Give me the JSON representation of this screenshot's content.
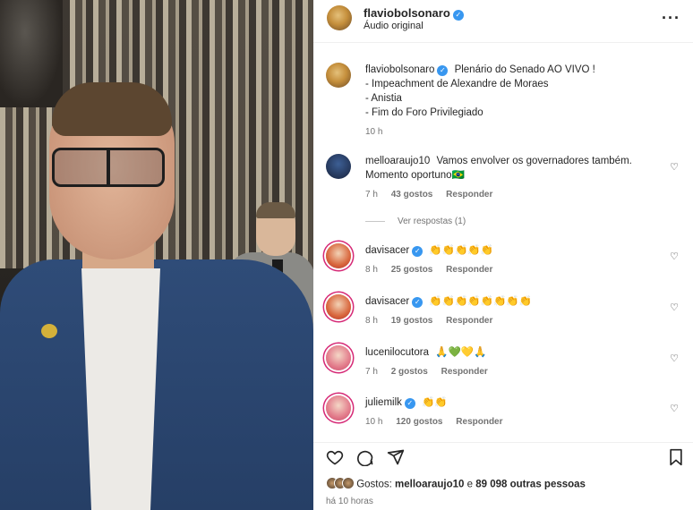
{
  "post": {
    "author": "flaviobolsonaro",
    "audio": "Áudio original",
    "more": "···",
    "caption": {
      "author": "flaviobolsonaro",
      "lines": [
        "Plenário do Senado AO VIVO !",
        "- Impeachment de Alexandre de Moraes",
        "- Anistia",
        "- Fim do Foro Privilegiado"
      ],
      "time": "10 h"
    }
  },
  "comments": [
    {
      "user": "melloaraujo10",
      "verified": false,
      "text_line1": "Vamos envolver os governadores também.",
      "text_line2": "Momento oportuno🇧🇷",
      "time": "7 h",
      "likes": "43 gostos",
      "reply": "Responder",
      "avatar": "avatar-blue"
    },
    {
      "user": "davisacer",
      "verified": true,
      "text": "👏👏👏👏👏",
      "time": "8 h",
      "likes": "25 gostos",
      "reply": "Responder",
      "avatar": "avatar-red"
    },
    {
      "user": "davisacer",
      "verified": true,
      "text": "👏👏👏👏👏👏👏👏",
      "time": "8 h",
      "likes": "19 gostos",
      "reply": "Responder",
      "avatar": "avatar-red"
    },
    {
      "user": "lucenilocutora",
      "verified": false,
      "text": "🙏💚💛🙏",
      "time": "7 h",
      "likes": "2 gostos",
      "reply": "Responder",
      "avatar": "avatar-pink"
    },
    {
      "user": "juliemilk",
      "verified": true,
      "text": "👏👏",
      "time": "10 h",
      "likes": "120 gostos",
      "reply": "Responder",
      "avatar": "avatar-pink"
    }
  ],
  "view_replies": "Ver respostas (1)",
  "likes_bar": {
    "prefix": "Gostos:",
    "user": "melloaraujo10",
    "connector": "e",
    "others": "89 098 outras pessoas"
  },
  "timeago": "há 10 horas",
  "icons": {
    "heart": "heart-icon",
    "comment": "comment-icon",
    "share": "share-icon",
    "save": "bookmark-icon",
    "verified": "verified-icon"
  },
  "colors": {
    "verified": "#3897f0",
    "muted": "#737373",
    "text": "#262626"
  }
}
